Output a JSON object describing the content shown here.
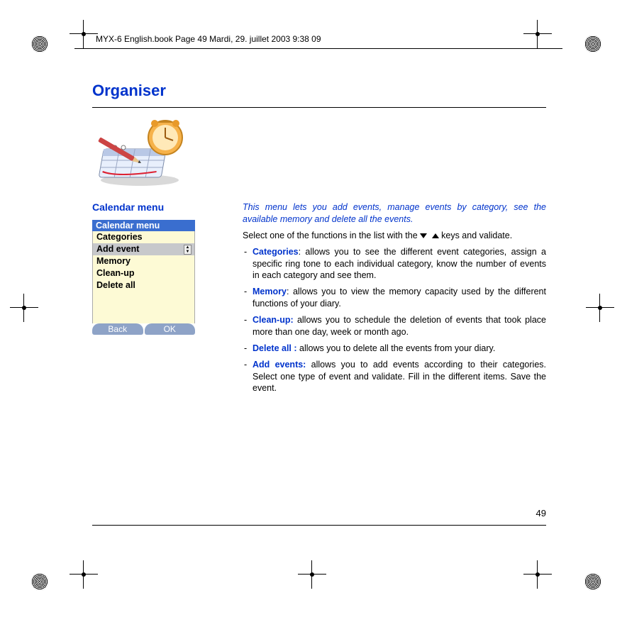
{
  "doc_header": "MYX-6 English.book  Page 49  Mardi, 29. juillet 2003  9:38 09",
  "page_number": "49",
  "title": "Organiser",
  "section_title": "Calendar menu",
  "phone": {
    "title": "Calendar menu",
    "items": [
      "Categories",
      "Add event",
      "Memory",
      "Clean-up",
      "Delete all"
    ],
    "selected_index": 1,
    "softkeys": {
      "left": "Back",
      "right": "OK"
    }
  },
  "intro": "This menu lets you add events, manage events by category, see the available memory and delete all the events.",
  "select_line_pre": "Select one of the functions in the list with the ",
  "select_line_post": " keys and validate.",
  "bullets": [
    {
      "label": "Categories",
      "sep": ": ",
      "text": "allows you to see the different event categories, assign a specific ring tone to each individual category, know the number of events in each category and see them."
    },
    {
      "label": "Memory",
      "sep": ": ",
      "text": "allows you to view the memory capacity used by the different functions of your diary."
    },
    {
      "label": "Clean-up:",
      "sep": " ",
      "text": "allows you to schedule the deletion of events that took place more than one day, week or month ago."
    },
    {
      "label": "Delete all :",
      "sep": " ",
      "text": "allows you to delete all the events from your diary."
    },
    {
      "label": "Add events:",
      "sep": " ",
      "text": "allows you to add events according to their categories. Select one type of event and validate. Fill in the different items. Save the event."
    }
  ]
}
